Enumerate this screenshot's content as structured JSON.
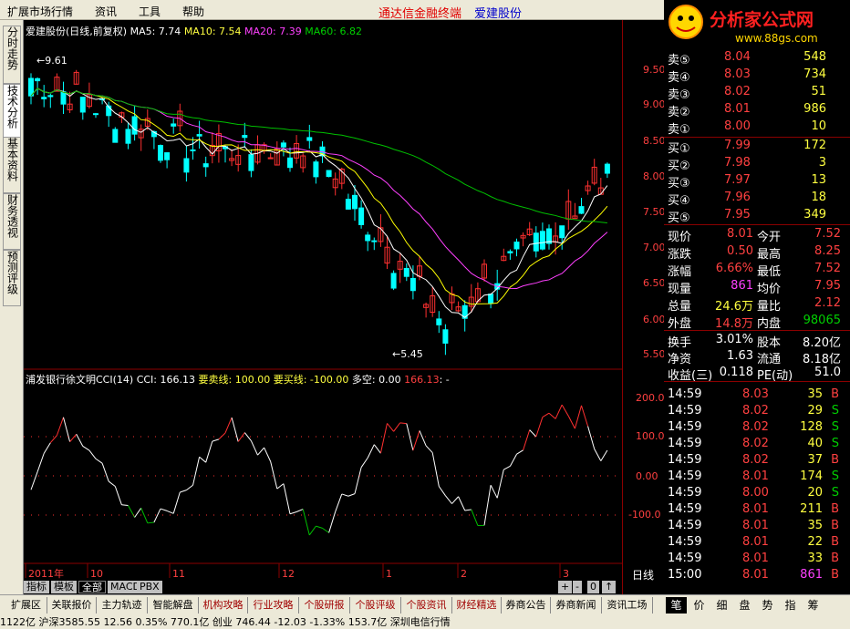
{
  "menu": {
    "items": [
      "扩展市场行情",
      "资讯",
      "工具",
      "帮助"
    ],
    "terminal_title": "通达信金融终端",
    "stock_title": "爱建股份"
  },
  "logo": {
    "name": "分析家公式网",
    "url": "www.88gs.com"
  },
  "left_tabs": [
    "分时走势",
    "技术分析",
    "基本资料",
    "财务透视",
    "预测评级"
  ],
  "main_chart": {
    "header_name": "爱建股份(日线,前复权)",
    "ma5": "MA5: 7.74",
    "ma10": "MA10: 7.54",
    "ma20": "MA20: 7.39",
    "ma60": "MA60: 6.82",
    "high_label": "9.61",
    "low_label": "5.45",
    "price_ticks": [
      "9.50",
      "9.00",
      "8.50",
      "8.00",
      "7.50",
      "7.00",
      "6.50",
      "6.00",
      "5.50"
    ],
    "colors": {
      "up": "#ff3030",
      "down": "#00ffff",
      "ma5": "#ffffff",
      "ma10": "#ffff00",
      "ma20": "#ff40ff",
      "ma60": "#00c000"
    }
  },
  "indicator": {
    "name": "浦发银行徐文明CCI(14)",
    "cci": "CCI: 166.13",
    "sell_label": "要卖线: 100.00",
    "buy_label": "要买线: -100.00",
    "duokong": "多空: 0.00",
    "last_value": "166.13",
    "last_suffix": ": -",
    "ticks": [
      "200.0",
      "100.0",
      "0.00",
      "-100.0"
    ]
  },
  "time_axis": [
    "2011年",
    "10",
    "11",
    "12",
    "1",
    "2",
    "3"
  ],
  "period_label": "日线",
  "sub_tabs": [
    "指标",
    "模板",
    "全部",
    "MACD",
    "PBX"
  ],
  "sub_controls": [
    "+",
    "-",
    "0",
    "↑"
  ],
  "orderbook": [
    {
      "label": "卖⑤",
      "price": "8.04",
      "vol": "548"
    },
    {
      "label": "卖④",
      "price": "8.03",
      "vol": "734"
    },
    {
      "label": "卖③",
      "price": "8.02",
      "vol": "51"
    },
    {
      "label": "卖②",
      "price": "8.01",
      "vol": "986"
    },
    {
      "label": "卖①",
      "price": "8.00",
      "vol": "10"
    },
    {
      "label": "买①",
      "price": "7.99",
      "vol": "172"
    },
    {
      "label": "买②",
      "price": "7.98",
      "vol": "3"
    },
    {
      "label": "买③",
      "price": "7.97",
      "vol": "13"
    },
    {
      "label": "买④",
      "price": "7.96",
      "vol": "18"
    },
    {
      "label": "买⑤",
      "price": "7.95",
      "vol": "349"
    }
  ],
  "stats": [
    {
      "l1": "现价",
      "v1": "8.01",
      "c1": "red",
      "l2": "今开",
      "v2": "7.52",
      "c2": "red"
    },
    {
      "l1": "涨跌",
      "v1": "0.50",
      "c1": "red",
      "l2": "最高",
      "v2": "8.25",
      "c2": "red"
    },
    {
      "l1": "涨幅",
      "v1": "6.66%",
      "c1": "red",
      "l2": "最低",
      "v2": "7.52",
      "c2": "red"
    },
    {
      "l1": "现量",
      "v1": "861",
      "c1": "magenta",
      "l2": "均价",
      "v2": "7.95",
      "c2": "red"
    },
    {
      "l1": "总量",
      "v1": "24.6万",
      "c1": "yellow",
      "l2": "量比",
      "v2": "2.12",
      "c2": "red"
    },
    {
      "l1": "外盘",
      "v1": "14.8万",
      "c1": "red",
      "l2": "内盘",
      "v2": "98065",
      "c2": "green"
    }
  ],
  "fund": [
    {
      "l1": "换手",
      "v1": "3.01%",
      "l2": "股本",
      "v2": "8.20亿"
    },
    {
      "l1": "净资",
      "v1": "1.63",
      "l2": "流通",
      "v2": "8.18亿"
    },
    {
      "l1": "收益(三)",
      "v1": "0.118",
      "l2": "PE(动)",
      "v2": "51.0"
    }
  ],
  "ticks_list": [
    {
      "time": "14:59",
      "price": "8.03",
      "vol": "35",
      "bs": "B"
    },
    {
      "time": "14:59",
      "price": "8.02",
      "vol": "29",
      "bs": "S"
    },
    {
      "time": "14:59",
      "price": "8.02",
      "vol": "128",
      "bs": "S"
    },
    {
      "time": "14:59",
      "price": "8.02",
      "vol": "40",
      "bs": "S"
    },
    {
      "time": "14:59",
      "price": "8.02",
      "vol": "37",
      "bs": "B"
    },
    {
      "time": "14:59",
      "price": "8.01",
      "vol": "174",
      "bs": "S"
    },
    {
      "time": "14:59",
      "price": "8.00",
      "vol": "20",
      "bs": "S"
    },
    {
      "time": "14:59",
      "price": "8.01",
      "vol": "211",
      "bs": "B"
    },
    {
      "time": "14:59",
      "price": "8.01",
      "vol": "35",
      "bs": "B"
    },
    {
      "time": "14:59",
      "price": "8.01",
      "vol": "22",
      "bs": "B"
    },
    {
      "time": "14:59",
      "price": "8.01",
      "vol": "33",
      "bs": "B"
    },
    {
      "time": "15:00",
      "price": "8.01",
      "vol": "861",
      "bs": "B"
    }
  ],
  "bottom_tabs": [
    "扩展区",
    "关联报价",
    "主力轨迹",
    "智能解盘",
    "机构攻略",
    "行业攻略",
    "个股研报",
    "个股评级",
    "个股资讯",
    "财经精选",
    "券商公告",
    "券商新闻",
    "资讯工场"
  ],
  "right_tabs": [
    "笔",
    "价",
    "细",
    "盘",
    "势",
    "指",
    "筹"
  ],
  "status": "1122亿  沪深3585.55  12.56  0.35%  770.1亿  创业  746.44  -12.03  -1.33%  153.7亿  深圳电信行情"
}
